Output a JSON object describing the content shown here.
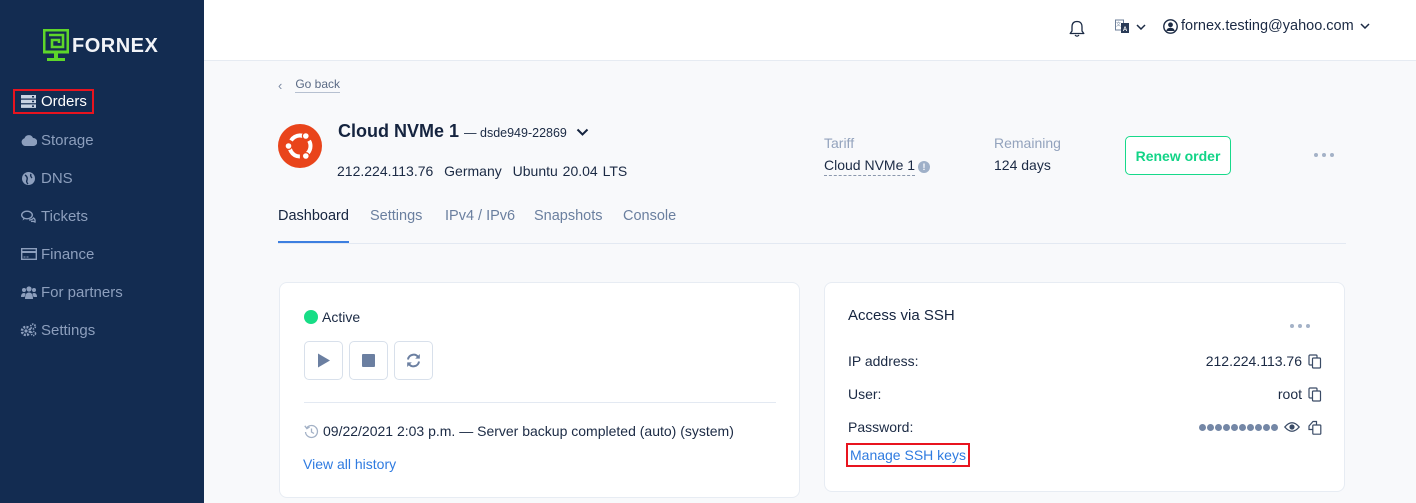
{
  "brand": {
    "name": "FORNEX",
    "logo_color": "#5ed62a"
  },
  "sidebar": {
    "items": [
      {
        "label": "Orders",
        "icon": "server-icon",
        "active": true
      },
      {
        "label": "Storage",
        "icon": "cloud-icon"
      },
      {
        "label": "DNS",
        "icon": "globe-icon"
      },
      {
        "label": "Tickets",
        "icon": "chat-icon"
      },
      {
        "label": "Finance",
        "icon": "credit-card-icon"
      },
      {
        "label": "For partners",
        "icon": "users-icon"
      },
      {
        "label": "Settings",
        "icon": "gears-icon"
      }
    ]
  },
  "topbar": {
    "notifications_icon": "bell-icon",
    "language_icon": "translate-icon",
    "user_email": "fornex.testing@yahoo.com"
  },
  "header": {
    "go_back": "Go back",
    "title": "Cloud NVMe 1",
    "server_id": "— dsde949-22869",
    "ip": "212.224.113.76",
    "location": "Germany",
    "os": "Ubuntu 20.04 LTS",
    "tariff_label": "Tariff",
    "tariff_value": "Cloud NVMe 1",
    "remaining_label": "Remaining",
    "remaining_value": "124 days",
    "renew_button": "Renew order"
  },
  "tabs": [
    {
      "label": "Dashboard",
      "active": true
    },
    {
      "label": "Settings"
    },
    {
      "label": "IPv4 / IPv6"
    },
    {
      "label": "Snapshots"
    },
    {
      "label": "Console"
    }
  ],
  "server_card": {
    "status": "Active",
    "status_color": "#17dd86",
    "controls": [
      "start",
      "stop",
      "restart"
    ],
    "last_event": "09/22/2021 2:03 p.m. — Server backup completed (auto) (system)",
    "view_all": "View all history"
  },
  "ssh_card": {
    "title": "Access via SSH",
    "ip_label": "IP address:",
    "ip_value": "212.224.113.76",
    "user_label": "User:",
    "user_value": "root",
    "password_label": "Password:",
    "password_masked_length": 10,
    "manage_keys": "Manage SSH keys"
  },
  "colors": {
    "sidebar_bg": "#132c51",
    "accent_green": "#17d98a",
    "link_blue": "#2f7be0",
    "highlight_red": "#e8141f",
    "ubuntu_orange": "#e9441b"
  }
}
